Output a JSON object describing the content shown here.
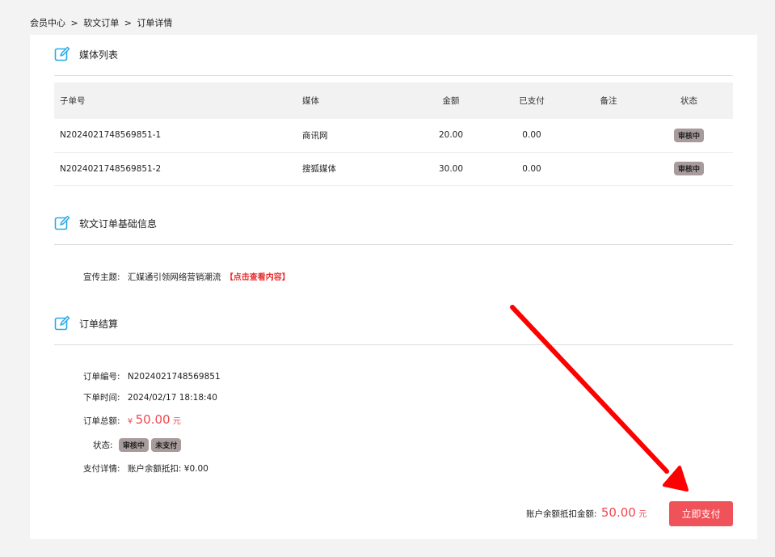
{
  "breadcrumb": {
    "item1": "会员中心",
    "sep1": ">",
    "item2": "软文订单",
    "sep2": ">",
    "item3": "订单详情"
  },
  "media_section": {
    "title": "媒体列表",
    "columns": [
      "子单号",
      "媒体",
      "金额",
      "已支付",
      "备注",
      "状态"
    ],
    "rows": [
      {
        "sub_order": "N2024021748569851-1",
        "media": "商讯网",
        "amount": "20.00",
        "paid": "0.00",
        "remark": "",
        "status": "审核中"
      },
      {
        "sub_order": "N2024021748569851-2",
        "media": "搜狐媒体",
        "amount": "30.00",
        "paid": "0.00",
        "remark": "",
        "status": "审核中"
      }
    ]
  },
  "basic_section": {
    "title": "软文订单基础信息",
    "theme_label": "宣传主题:",
    "theme_value": "汇媒通引领网络营销潮流",
    "view_link": "【点击查看内容】"
  },
  "settle_section": {
    "title": "订单结算",
    "order_no_label": "订单编号:",
    "order_no": "N2024021748569851",
    "time_label": "下单时间:",
    "time": "2024/02/17 18:18:40",
    "total_label": "订单总额:",
    "total_currency": "¥",
    "total_value": "50.00",
    "total_unit": "元",
    "status_label": "状态:",
    "status_review": "审核中",
    "status_unpaid": "未支付",
    "pay_detail_label": "支付详情:",
    "pay_detail_value": "账户余额抵扣: ¥0.00"
  },
  "footer": {
    "deduct_label": "账户余额抵扣金额:",
    "deduct_value": "50.00",
    "deduct_unit": "元",
    "pay_button": "立即支付"
  },
  "colors": {
    "accent_red": "#f0484f",
    "button_red": "#f0525a",
    "badge_gray": "#a89b9b",
    "icon_blue": "#29a9e8",
    "arrow_red": "#ff0000"
  },
  "icons": {
    "section_icon": "edit-icon"
  }
}
